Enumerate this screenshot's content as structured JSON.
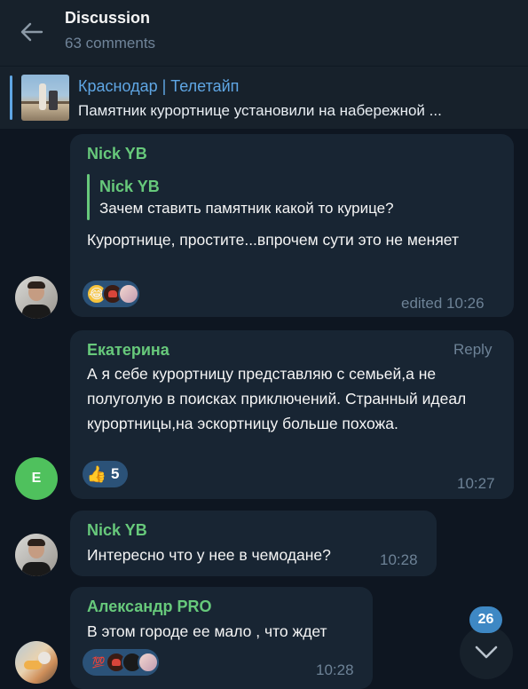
{
  "header": {
    "title": "Discussion",
    "subtitle": "63 comments"
  },
  "pinned": {
    "channel": "Краснодар | Телетайп",
    "text": "Памятник курортнице установили на набережной ..."
  },
  "messages": [
    {
      "author": "Nick YB",
      "quote_author": "Nick YB",
      "quote_text": "Зачем ставить памятник какой то курице?",
      "text": "Курортнице, простите...впрочем сути это не меняет",
      "reactions": [
        "rolling-laughing-emoji",
        "candle-emoji",
        "girl-sticker-emoji"
      ],
      "time": "edited 10:26"
    },
    {
      "author": "Екатерина",
      "avatar_letter": "Е",
      "reply_label": "Reply",
      "text": "А я себе курортницу представляю с семьей,а не полуголую в поисках приключений. Странный идеал курортницы,на эскортницу больше похожа.",
      "reaction_icon": "thumbs-up-emoji",
      "reaction_count": "5",
      "time": "10:27"
    },
    {
      "author": "Nick YB",
      "text": "Интересно что у нее в чемодане?",
      "time": "10:28"
    },
    {
      "author": "Александр PRO",
      "text": "В этом городе ее мало , что ждет",
      "reactions": [
        "hundred-emoji",
        "candle-emoji",
        "black-cat-emoji",
        "girl-sticker-emoji"
      ],
      "time": "10:28"
    }
  ],
  "scroll": {
    "unread_count": "26"
  },
  "colors": {
    "background": "#0e1621",
    "bubble": "#182533",
    "name": "#67c97b",
    "link": "#5fa6e4",
    "reaction": "#2b5278"
  }
}
